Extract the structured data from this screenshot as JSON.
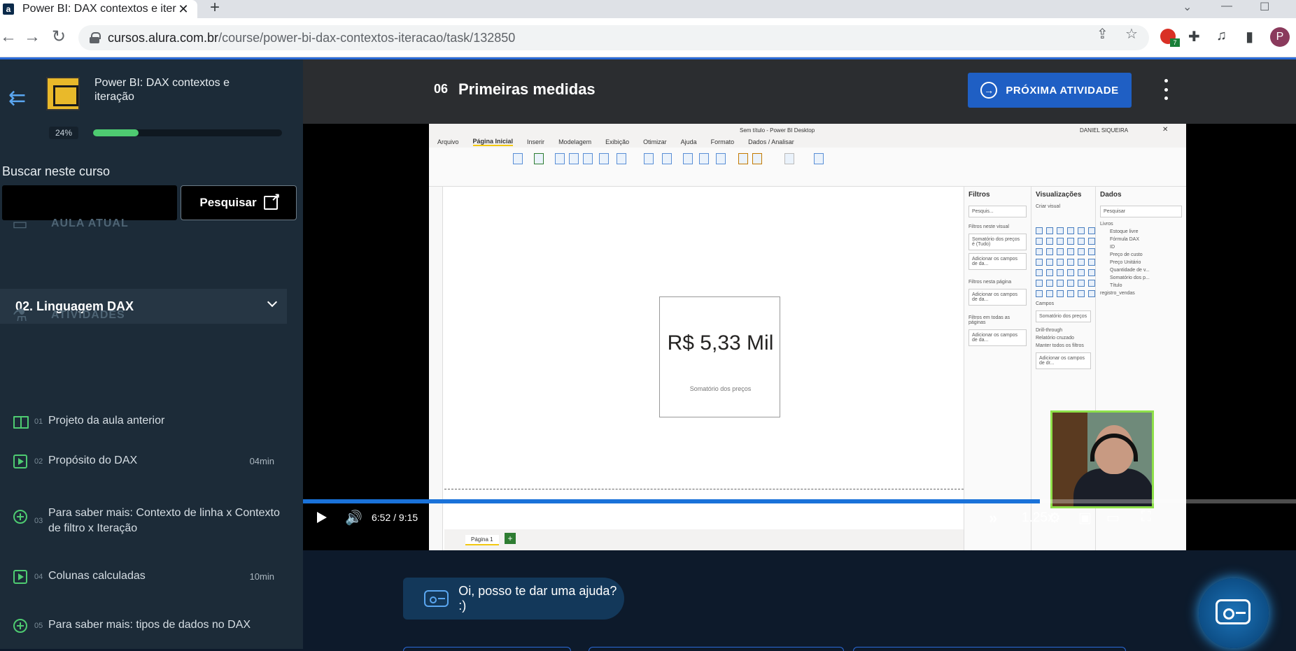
{
  "browser": {
    "tab_title": "Power BI: DAX contextos e iteraç",
    "tab_favicon": "a",
    "url_host": "cursos.alura.com.br",
    "url_path": "/course/power-bi-dax-contextos-iteracao/task/132850",
    "profile_initial": "P",
    "ext_badge": "7"
  },
  "sidebar": {
    "course_title": "Power BI: DAX contextos e iteração",
    "progress_label": "24%",
    "progress": 0.24,
    "search_label": "Buscar neste curso",
    "search_value": "",
    "search_button": "Pesquisar",
    "current_section": "AULA ATUAL",
    "current_lesson": "02. Linguagem DAX",
    "activities_section": "ATIVIDADES",
    "activities": [
      {
        "num": "01",
        "title": "Projeto da aula anterior",
        "duration": "",
        "icon": "book-icon"
      },
      {
        "num": "02",
        "title": "Propósito do DAX",
        "duration": "04min",
        "icon": "play-icon"
      },
      {
        "num": "03",
        "title": "Para saber mais: Contexto de linha x Contexto de filtro x Iteração",
        "duration": "",
        "icon": "plus-circle-icon"
      },
      {
        "num": "04",
        "title": "Colunas calculadas",
        "duration": "10min",
        "icon": "play-icon"
      },
      {
        "num": "05",
        "title": "Para saber mais: tipos de dados no DAX",
        "duration": "",
        "icon": "plus-circle-icon"
      }
    ]
  },
  "header": {
    "activity_number": "06",
    "activity_title": "Primeiras medidas",
    "next_button": "PRÓXIMA ATIVIDADE"
  },
  "video": {
    "current_time": "6:52",
    "separator": "/",
    "total_time": "9:15",
    "progress": 0.742,
    "speed": "1.25x",
    "pbi": {
      "window_title": "Sem título - Power BI Desktop",
      "user": "DANIEL SIQUEIRA",
      "menu": [
        "Arquivo",
        "Página Inicial",
        "Inserir",
        "Modelagem",
        "Exibição",
        "Otimizar",
        "Ajuda",
        "Formato",
        "Dados / Analisar"
      ],
      "card_value": "R$ 5,33 Mil",
      "card_label": "Somatório dos preços",
      "page_tab": "Página 1",
      "filters_title": "Filtros",
      "filters_search": "Pesquis...",
      "filters_visual": "Filtros neste visual",
      "filter_field": "Somatório dos preços é (Tudo)",
      "add_fields": "Adicionar os campos de da...",
      "filters_page": "Filtros nesta página",
      "filters_all": "Filtros em todas as páginas",
      "viz_title": "Visualizações",
      "viz_build": "Criar visual",
      "viz_fields": "Campos",
      "viz_field_value": "Somatório dos preços",
      "drill": "Drill-through",
      "cross_report": "Relatório cruzado",
      "keep_filters": "Manter todos os filtros",
      "add_drill": "Adicionar os campos de dr...",
      "data_title": "Dados",
      "data_search": "Pesquisar",
      "data_tables": [
        "Livros",
        "Estoque livre",
        "Fórmula DAX",
        "ID",
        "Preço de custo",
        "Preço Unitário",
        "Quantidade de v...",
        "Somatório dos p...",
        "Título",
        "registro_vendas"
      ]
    }
  },
  "chat": {
    "message": "Oi, posso te dar uma ajuda? :)"
  }
}
